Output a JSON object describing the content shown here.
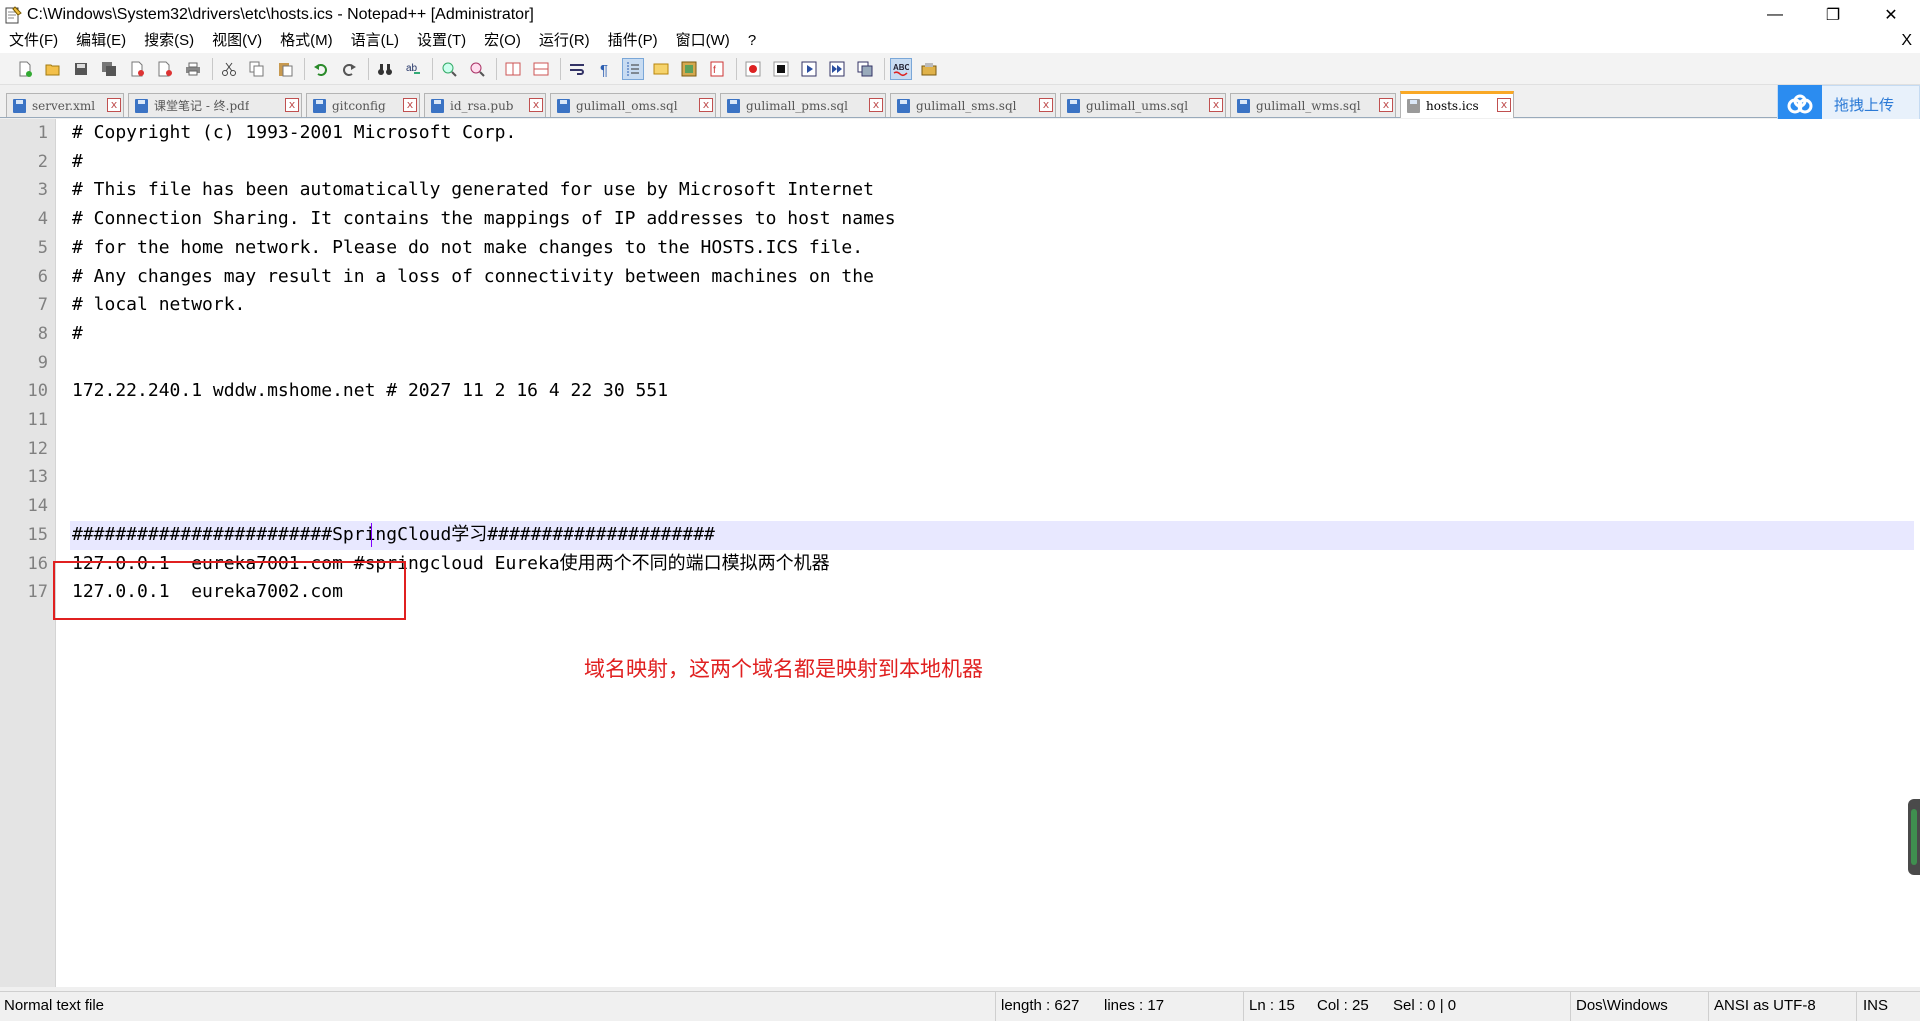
{
  "window": {
    "title": "C:\\Windows\\System32\\drivers\\etc\\hosts.ics - Notepad++ [Administrator]",
    "minimize": "—",
    "restore": "❐",
    "close": "✕"
  },
  "menu": {
    "items": [
      "文件(F)",
      "编辑(E)",
      "搜索(S)",
      "视图(V)",
      "格式(M)",
      "语言(L)",
      "设置(T)",
      "宏(O)",
      "运行(R)",
      "插件(P)",
      "窗口(W)",
      "?"
    ],
    "close": "X"
  },
  "tabs": [
    {
      "label": "server.xml",
      "active": false
    },
    {
      "label": "课堂笔记 - 终.pdf",
      "active": false
    },
    {
      "label": "gitconfig",
      "active": false
    },
    {
      "label": "id_rsa.pub",
      "active": false
    },
    {
      "label": "gulimall_oms.sql",
      "active": false
    },
    {
      "label": "gulimall_pms.sql",
      "active": false
    },
    {
      "label": "gulimall_sms.sql",
      "active": false
    },
    {
      "label": "gulimall_ums.sql",
      "active": false
    },
    {
      "label": "gulimall_wms.sql",
      "active": false
    },
    {
      "label": "hosts.ics",
      "active": true
    }
  ],
  "tab_close": "x",
  "upload_widget": {
    "label": "拖拽上传"
  },
  "editor": {
    "lines": [
      {
        "n": "1",
        "text": "# Copyright (c) 1993-2001 Microsoft Corp."
      },
      {
        "n": "2",
        "text": "#"
      },
      {
        "n": "3",
        "text": "# This file has been automatically generated for use by Microsoft Internet"
      },
      {
        "n": "4",
        "text": "# Connection Sharing. It contains the mappings of IP addresses to host names"
      },
      {
        "n": "5",
        "text": "# for the home network. Please do not make changes to the HOSTS.ICS file."
      },
      {
        "n": "6",
        "text": "# Any changes may result in a loss of connectivity between machines on the"
      },
      {
        "n": "7",
        "text": "# local network."
      },
      {
        "n": "8",
        "text": "#"
      },
      {
        "n": "9",
        "text": ""
      },
      {
        "n": "10",
        "text": "172.22.240.1 wddw.mshome.net # 2027 11 2 16 4 22 30 551"
      },
      {
        "n": "11",
        "text": ""
      },
      {
        "n": "12",
        "text": ""
      },
      {
        "n": "13",
        "text": ""
      },
      {
        "n": "14",
        "text": ""
      },
      {
        "n": "15",
        "text": "########################SpringCloud学习#####################"
      },
      {
        "n": "16",
        "text": "127.0.0.1  eureka7001.com #springcloud Eureka使用两个不同的端口模拟两个机器"
      },
      {
        "n": "17",
        "text": "127.0.0.1  eureka7002.com"
      }
    ],
    "current_line": 15
  },
  "annotation": "域名映射，这两个域名都是映射到本地机器",
  "status": {
    "file_type": "Normal text file",
    "length": "length : 627",
    "lines": "lines : 17",
    "ln": "Ln : 15",
    "col": "Col : 25",
    "sel": "Sel : 0 | 0",
    "eol": "Dos\\Windows",
    "encoding": "ANSI as UTF-8",
    "mode": "INS"
  },
  "colors": {
    "annotation": "#e02020",
    "current_line_bg": "#e8e8ff",
    "active_tab_accent": "#f9a825"
  }
}
